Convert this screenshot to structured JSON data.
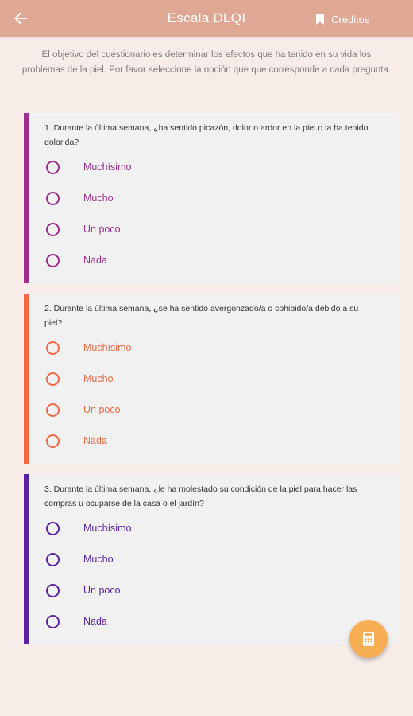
{
  "appbar": {
    "title": "Escala DLQI",
    "credits_label": "Créditos",
    "back_icon": "arrow-back-icon",
    "credits_icon": "bookmark-icon"
  },
  "intro": "El objetivo del cuestionario es determinar los efectos que ha tenido en su vida los problemas de la piel. Por favor seleccione la opción que que corresponde a cada pregunta.",
  "colors": {
    "q1": "#9c2f8c",
    "q2": "#ef6a45",
    "q3": "#5c22a3",
    "fab": "#f8ae53",
    "appbar": "#dfa894"
  },
  "questions": [
    {
      "text": "1. Durante la última semana, ¿ha sentido picazón, dolor o ardor en la piel o la ha tenido dolorida?",
      "options": [
        "Muchísimo",
        "Mucho",
        "Un poco",
        "Nada"
      ]
    },
    {
      "text": "2. Durante la última semana, ¿se ha sentido avergonzado/a o cohibido/a debido a su piel?",
      "options": [
        "Muchísimo",
        "Mucho",
        "Un poco",
        "Nada"
      ]
    },
    {
      "text": "3. Durante la última semana, ¿le ha molestado su condición de la piel para hacer las compras u ocuparse de la casa o el jardín?",
      "options": [
        "Muchísimo",
        "Mucho",
        "Un poco",
        "Nada"
      ]
    }
  ],
  "fab": {
    "icon": "calculator-icon"
  }
}
